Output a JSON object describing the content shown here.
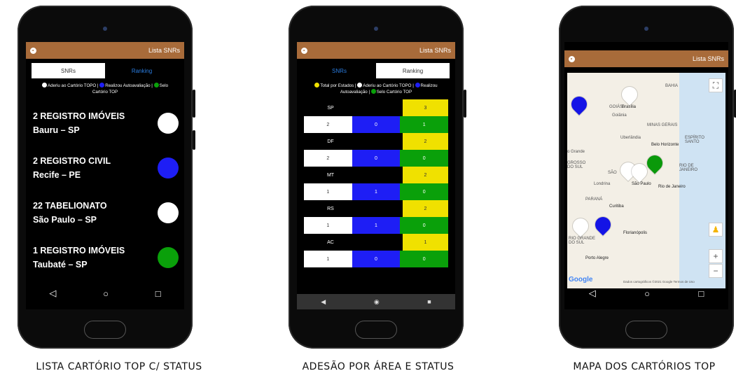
{
  "phones": {
    "left": {
      "header_title": "Lista SNRs",
      "tabs": [
        "SNRs",
        "Ranking"
      ],
      "legend": {
        "a": "Aderiu ao Cartório TOPO |",
        "b": "Realizou Autoavaliação |",
        "c": "Selo",
        "d": "Cartório TOP"
      },
      "items": [
        {
          "line1": "2 REGISTRO IMÓVEIS",
          "line2": "Bauru – SP",
          "color": "#ffffff"
        },
        {
          "line1": "2 REGISTRO CIVIL",
          "line2": "Recife – PE",
          "color": "#1e1ef5"
        },
        {
          "line1": "22 TABELIONATO",
          "line2": "São Paulo – SP",
          "color": "#ffffff"
        },
        {
          "line1": "1 REGISTRO IMÓVEIS",
          "line2": "Taubaté – SP",
          "color": "#0aa00a"
        }
      ],
      "nav": [
        "◁",
        "○",
        "□"
      ]
    },
    "middle": {
      "header_title": "Lista SNRs",
      "tabs": [
        "SNRs",
        "Ranking"
      ],
      "legend": {
        "a": "Total por Estados |",
        "b": "Aderiu ao Cartório TOPO |",
        "c": "Realizou",
        "d": "Autoavaliação |",
        "e": "Selo Cartório TOP"
      },
      "rows": [
        {
          "state": "SP",
          "total": "3",
          "white": "2",
          "blue": "0",
          "green": "1"
        },
        {
          "state": "DF",
          "total": "2",
          "white": "2",
          "blue": "0",
          "green": "0"
        },
        {
          "state": "MT",
          "total": "2",
          "white": "1",
          "blue": "1",
          "green": "0"
        },
        {
          "state": "RS",
          "total": "2",
          "white": "1",
          "blue": "1",
          "green": "0"
        },
        {
          "state": "AC",
          "total": "1",
          "white": "1",
          "blue": "0",
          "green": "0"
        }
      ],
      "nav": [
        "◀",
        "◉",
        "■"
      ]
    },
    "right": {
      "header_title": "Lista SNRs",
      "map_labels": {
        "bahia": "BAHIA",
        "goias": "GOIÁS",
        "brasilia": "Brasília",
        "goiania": "Goiânia",
        "minas": "MINAS GERAIS",
        "uberlandia": "Uberlândia",
        "bh": "Belo Horizonte",
        "espirito": "ESPÍRITO SANTO",
        "grande": "o Grande",
        "grosso": "GROSSO DO SUL",
        "sao": "SÃO",
        "rj_state": "RIO DE JANEIRO",
        "londrina": "Londrina",
        "saopaulo": "São Paulo",
        "rio": "Rio de Janeiro",
        "parana": "PARANÁ",
        "curitiba": "Curitiba",
        "floripa": "Florianópolis",
        "rs": "RIO GRANDE DO SUL",
        "poa": "Porto Alegre",
        "google": "Google",
        "attribution": "Dados cartográficos ©2021 Google   Termos de Uso"
      },
      "nav": [
        "◁",
        "○",
        "□"
      ]
    }
  },
  "captions": {
    "left": "LISTA CARTÓRIO TOP C/ STATUS",
    "middle": "ADESÃO POR ÁREA E STATUS",
    "right": "MAPA DOS CARTÓRIOS TOP"
  }
}
